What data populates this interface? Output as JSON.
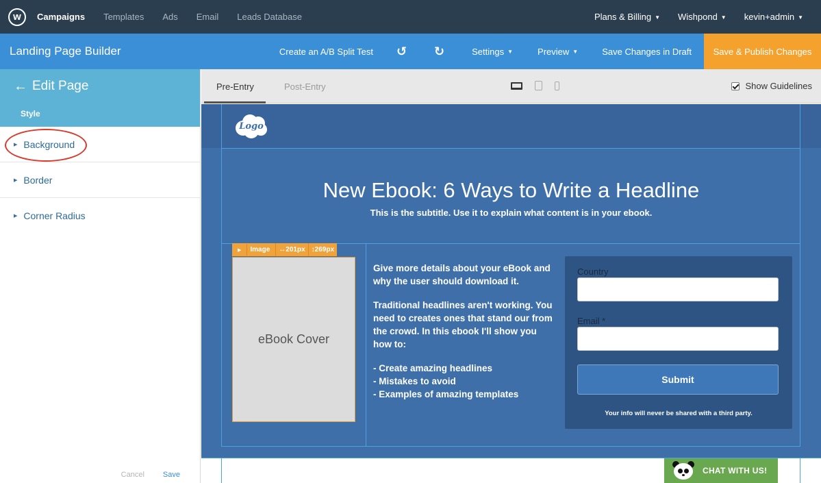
{
  "topnav": {
    "logo_letter": "w",
    "items": [
      "Campaigns",
      "Templates",
      "Ads",
      "Email",
      "Leads Database"
    ],
    "right_items": [
      "Plans & Billing",
      "Wishpond",
      "kevin+admin"
    ]
  },
  "builder": {
    "title": "Landing Page Builder",
    "ab_test": "Create an A/B Split Test",
    "undo_icon": "undo-icon",
    "redo_icon": "redo-icon",
    "settings": "Settings",
    "preview": "Preview",
    "save_draft": "Save Changes in Draft",
    "publish": "Save & Publish Changes"
  },
  "left_panel": {
    "title": "Edit Page",
    "tab": "Style",
    "rows": [
      "Background",
      "Border",
      "Corner Radius"
    ],
    "cancel": "Cancel",
    "save": "Save"
  },
  "canvas": {
    "tabs": [
      "Pre-Entry",
      "Post-Entry"
    ],
    "show_guidelines": "Show Guidelines"
  },
  "page": {
    "logo_text": "Logo",
    "headline": "New Ebook: 6 Ways to Write a Headline",
    "subtitle": "This is the subtitle. Use it to explain what content is in your ebook.",
    "image_toolbar": {
      "label": "Image",
      "width": "↔201px",
      "height": "↕269px"
    },
    "ebook_cover": "eBook Cover",
    "details": {
      "p1": "Give more details about your eBook and why the user should download it.",
      "p2": "Traditional headlines aren't working. You need to creates ones that stand our from the crowd. In this ebook I'll show you how to:",
      "bullets": [
        "-  Create amazing headlines",
        "-  Mistakes to avoid",
        "-  Examples of amazing templates"
      ]
    },
    "form": {
      "country_label": "Country",
      "email_label": "Email *",
      "submit": "Submit",
      "privacy": "Your info will never be shared with a third party."
    }
  },
  "chat": {
    "label": "CHAT WITH US!"
  },
  "colors": {
    "nav": "#2b3e50",
    "builder": "#3a8fd6",
    "publish": "#f4a22d",
    "panel_header": "#5db3d6",
    "page_bg": "#3e6fa9",
    "chat": "#6aa84f"
  }
}
